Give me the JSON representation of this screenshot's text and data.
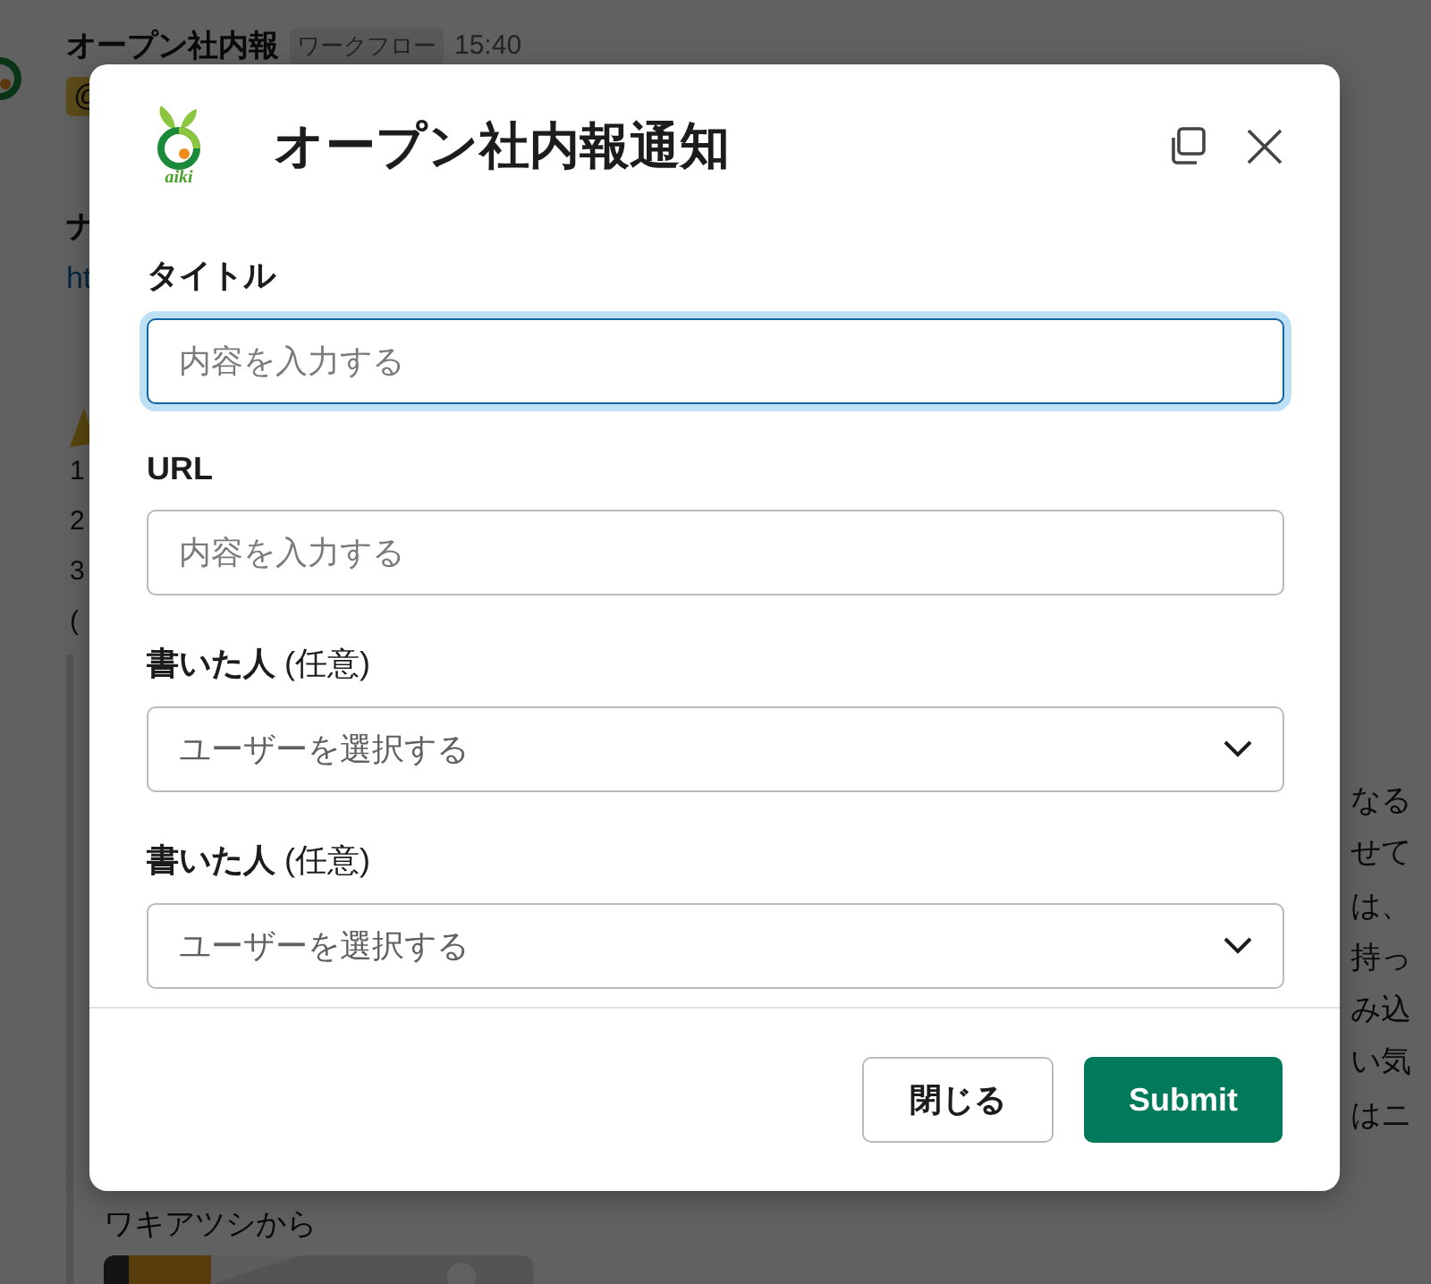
{
  "background": {
    "sender": "オープン社内報",
    "badge": "ワークフロー",
    "time": "15:40",
    "mention": "@",
    "lines_top": [
      "ナ",
      "ht"
    ],
    "list_lines": [
      "1",
      "2",
      "3",
      "("
    ],
    "fragments_right": [
      "なる",
      "せて",
      "は、",
      "持っ",
      "み込",
      "い気",
      "はニ"
    ],
    "footer": "ワキアツシから"
  },
  "modal": {
    "logo_text": "aiki",
    "title": "オープン社内報通知",
    "fields": [
      {
        "kind": "text",
        "label": "タイトル",
        "placeholder": "内容を入力する",
        "focused": true
      },
      {
        "kind": "text",
        "label": "URL",
        "placeholder": "内容を入力する",
        "focused": false
      },
      {
        "kind": "select",
        "label": "書いた人",
        "note": "(任意)",
        "placeholder": "ユーザーを選択する",
        "focused": false
      },
      {
        "kind": "select",
        "label": "書いた人",
        "note": "(任意)",
        "placeholder": "ユーザーを選択する",
        "focused": false
      }
    ],
    "buttons": [
      {
        "label": "閉じる",
        "kind": "secondary"
      },
      {
        "label": "Submit",
        "kind": "primary"
      }
    ]
  }
}
